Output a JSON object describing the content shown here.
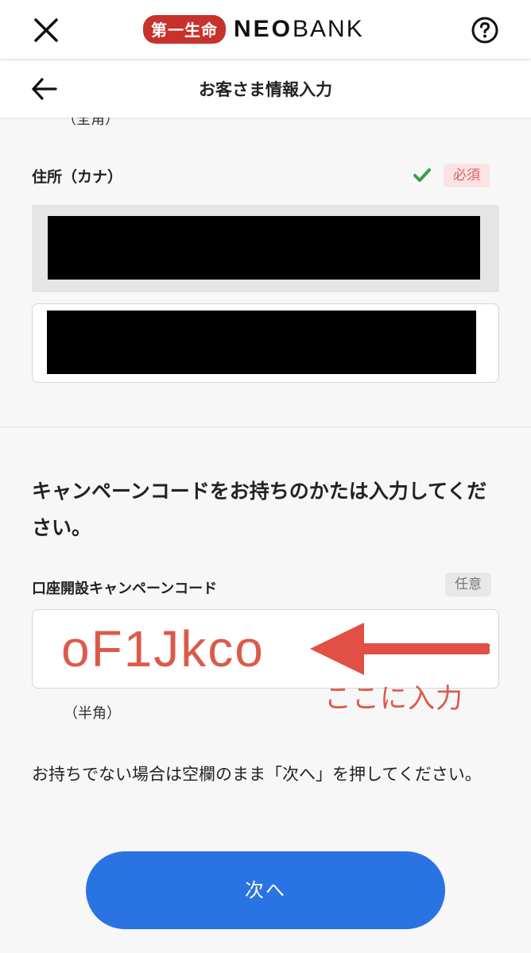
{
  "header": {
    "logo_badge_text": "第一生命",
    "logo_neo": "NEO",
    "logo_bank": "BANK",
    "close_icon": "close-icon",
    "help_icon": "help-icon"
  },
  "subheader": {
    "title": "お客さま情報入力",
    "back_icon": "back-arrow-icon"
  },
  "address_kana": {
    "previous_field_hint": "（全角）",
    "label": "住所（カナ）",
    "required_badge": "必須",
    "valid_icon": "check-icon"
  },
  "campaign": {
    "heading": "キャンペーンコードをお持ちのかたは入力してください。",
    "label": "口座開設キャンペーンコード",
    "optional_badge": "任意",
    "code_value": "oF1Jkco",
    "annotation": "ここに入力",
    "hint": "（半角）",
    "note": "お持ちでない場合は空欄のまま「次へ」を押してください。"
  },
  "next_button": {
    "label": "次へ"
  },
  "colors": {
    "primary": "#2a73e3",
    "brand_red": "#c8322c",
    "annotation_red": "#dc5a4a",
    "required_bg": "#fbe3e4",
    "check_green": "#3aa04a"
  }
}
